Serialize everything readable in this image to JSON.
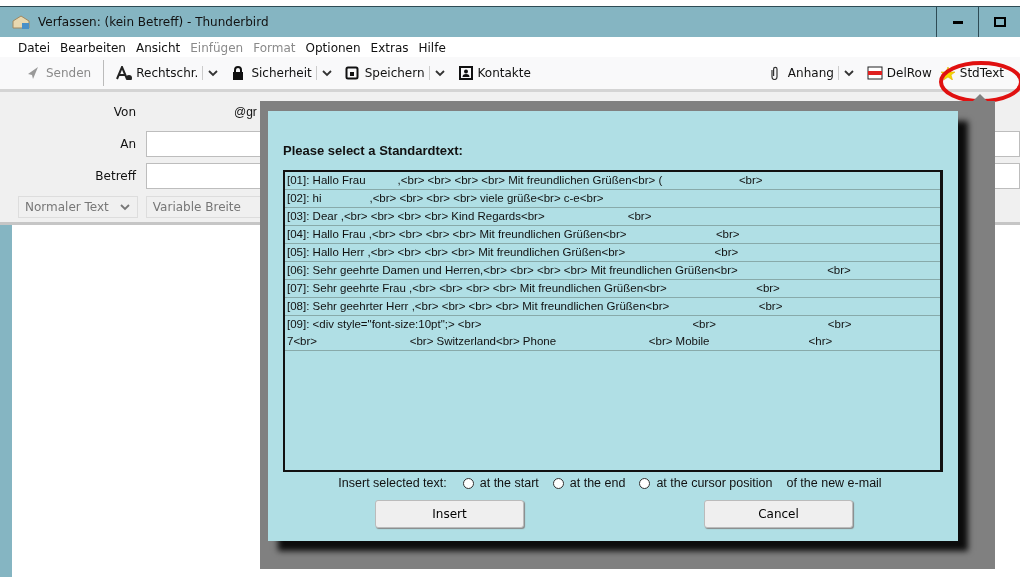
{
  "window": {
    "title": "Verfassen: (kein Betreff) - Thunderbird"
  },
  "menu": [
    {
      "label": "Datei",
      "disabled": false
    },
    {
      "label": "Bearbeiten",
      "disabled": false
    },
    {
      "label": "Ansicht",
      "disabled": false
    },
    {
      "label": "Einfügen",
      "disabled": true
    },
    {
      "label": "Format",
      "disabled": true
    },
    {
      "label": "Optionen",
      "disabled": false
    },
    {
      "label": "Extras",
      "disabled": false
    },
    {
      "label": "Hilfe",
      "disabled": false
    }
  ],
  "toolbar_left": [
    {
      "label": "Senden",
      "kind": "button",
      "disabled": true
    },
    {
      "label": "Rechtschr.",
      "kind": "split",
      "disabled": false
    },
    {
      "label": "Sicherheit",
      "kind": "split",
      "disabled": false
    },
    {
      "label": "Speichern",
      "kind": "split",
      "disabled": false
    },
    {
      "label": "Kontakte",
      "kind": "button",
      "disabled": false
    }
  ],
  "toolbar_right": [
    {
      "label": "Anhang",
      "kind": "split",
      "disabled": false
    },
    {
      "label": "DelRow",
      "kind": "button",
      "disabled": false
    },
    {
      "label": "StdText",
      "kind": "button",
      "disabled": false
    }
  ],
  "header": {
    "from_label": "Von",
    "from_value": "@gr",
    "to_label": "An",
    "subject_label": "Betreff"
  },
  "format_bar": {
    "paragraph": "Normaler Text",
    "font": "Variable Breite"
  },
  "dialog": {
    "heading": "Please select a Standardtext:",
    "rows": [
      {
        "lines": [
          "[01]: Hallo Frau          ,<br> <br> <br> <br> Mit freundlichen Grüßen<br> (                        <br>"
        ],
        "selected": false
      },
      {
        "lines": [
          "[02]: hi               ,<br> <br> <br> <br> viele grüße<br> c-e<br>"
        ],
        "selected": false
      },
      {
        "lines": [
          "[03]: Dear ,<br> <br> <br> <br> Kind Regards<br>                          <br>"
        ],
        "selected": false
      },
      {
        "lines": [
          "[04]: Hallo Frau ,<br> <br> <br> <br> Mit freundlichen Grüßen<br>                            <br>"
        ],
        "selected": false
      },
      {
        "lines": [
          "[05]: Hallo Herr ,<br> <br> <br> <br> Mit freundlichen Grüßen<br>                            <br>"
        ],
        "selected": false
      },
      {
        "lines": [
          "[06]: Sehr geehrte Damen und Herren,<br> <br> <br> <br> Mit freundlichen Grüßen<br>                            <br>"
        ],
        "selected": false
      },
      {
        "lines": [
          "[07]: Sehr geehrte Frau ,<br> <br> <br> <br> Mit freundlichen Grüßen<br>                            <br>"
        ],
        "selected": false
      },
      {
        "lines": [
          "[08]: Sehr geehrter Herr ,<br> <br> <br> <br> Mit freundlichen Grüßen<br>                            <br>"
        ],
        "selected": false
      },
      {
        "lines": [
          "[09]: <div style=\"font-size:10pt\";> <br>                                                                  <br>                                   <br>",
          "7<br>                             <br> Switzerland<br> Phone                             <br> Mobile                               <hr>"
        ],
        "selected": false
      }
    ],
    "insert_label": "Insert selected text:",
    "positions": [
      {
        "label": "at the start",
        "selected": false
      },
      {
        "label": "at the end",
        "selected": false
      },
      {
        "label": "at the cursor position",
        "selected": false
      }
    ],
    "suffix": "of the new e-mail",
    "buttons": [
      "Insert",
      "Cancel"
    ]
  }
}
